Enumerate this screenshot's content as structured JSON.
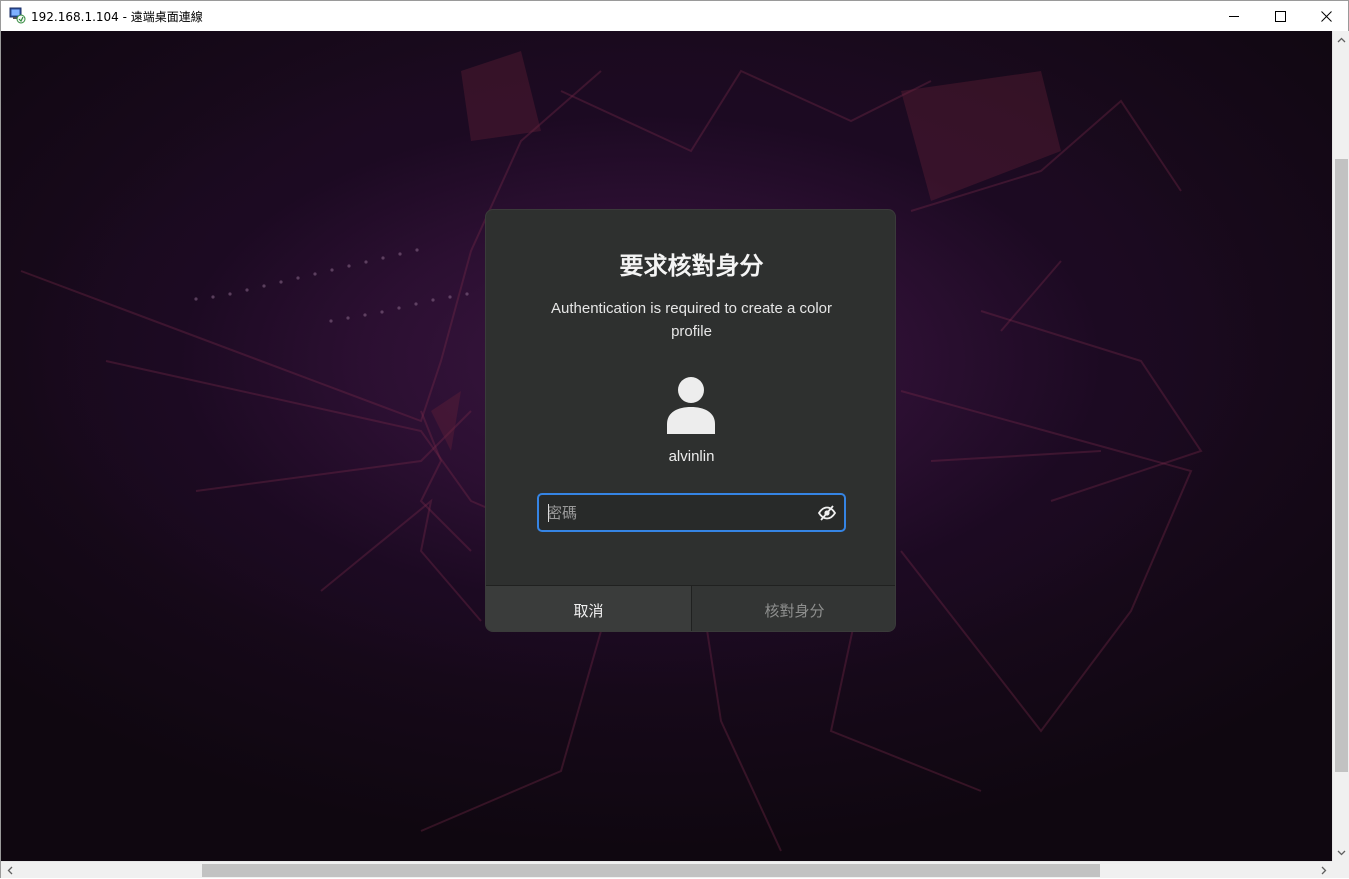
{
  "window": {
    "title": "192.168.1.104 - 遠端桌面連線",
    "minimize_icon": "minimize-icon",
    "maximize_icon": "maximize-icon",
    "close_icon": "close-icon"
  },
  "dialog": {
    "title": "要求核對身分",
    "message": "Authentication is required to create a color profile",
    "avatar_icon": "user-avatar-icon",
    "username": "alvinlin",
    "password": {
      "value": "",
      "placeholder": "密碼",
      "reveal_icon": "eye-slash-icon"
    },
    "cancel_label": "取消",
    "authenticate_label": "核對身分"
  },
  "colors": {
    "accent": "#3584e4",
    "dialog_bg": "#2e302f"
  }
}
